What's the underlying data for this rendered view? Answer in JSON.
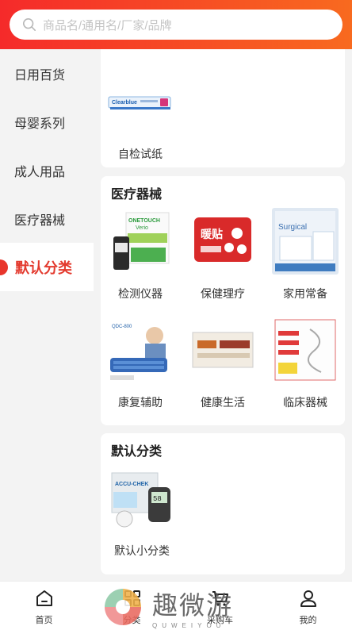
{
  "search": {
    "placeholder": "商品名/通用名/厂家/品牌"
  },
  "sidebar": {
    "items": [
      {
        "label": "日用百货"
      },
      {
        "label": "母婴系列"
      },
      {
        "label": "成人用品"
      },
      {
        "label": "医疗器械"
      },
      {
        "label": "默认分类",
        "active": true
      }
    ]
  },
  "sections": [
    {
      "title": "",
      "items": [
        {
          "label": "自检试纸",
          "image": "clearblue-test-strip"
        }
      ]
    },
    {
      "title": "医疗器械",
      "items": [
        {
          "label": "检测仪器",
          "image": "onetouch-verio-strips"
        },
        {
          "label": "保健理疗",
          "image": "heating-patch-pack"
        },
        {
          "label": "家用常备",
          "image": "surgical-supplies-box"
        },
        {
          "label": "康复辅助",
          "image": "qdc-800-air-mattress"
        },
        {
          "label": "健康生活",
          "image": "waist-support-belt"
        },
        {
          "label": "临床器械",
          "image": "catheter-package"
        }
      ]
    },
    {
      "title": "默认分类",
      "items": [
        {
          "label": "默认小分类",
          "image": "accu-chek-glucose-meter"
        }
      ]
    }
  ],
  "tabbar": {
    "items": [
      {
        "label": "首页",
        "icon": "home-icon"
      },
      {
        "label": "分类",
        "icon": "category-icon"
      },
      {
        "label": "采购车",
        "icon": "cart-icon"
      },
      {
        "label": "我的",
        "icon": "user-icon"
      }
    ]
  },
  "watermark": {
    "text": "趣微游",
    "sub": "QUWEIYOU"
  },
  "colors": {
    "accent": "#e8352b",
    "header_start": "#f52a2a",
    "header_end": "#f86a1f"
  }
}
